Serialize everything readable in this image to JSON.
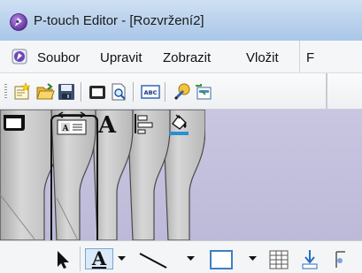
{
  "window": {
    "title": "P-touch Editor - [Rozvržení2]"
  },
  "menubar": {
    "items": [
      "Soubor",
      "Upravit",
      "Zobrazit",
      "Vložit",
      "F"
    ]
  },
  "toolbar": {
    "buttons": [
      "new-layout",
      "open",
      "save",
      "print",
      "print-preview",
      "text-abc",
      "wizard",
      "label-view"
    ]
  },
  "dock": {
    "tabs": [
      "paper-tab",
      "text-box-tab",
      "text-tab",
      "alignment-tab",
      "fill-tab"
    ],
    "selected_tab": "text-box-tab"
  },
  "drawbar": {
    "text_tool_label": "A"
  },
  "colors": {
    "dock_background": "#c2c0dc",
    "tab_face": "#bfbfbf",
    "selection_frame": "#111111"
  }
}
